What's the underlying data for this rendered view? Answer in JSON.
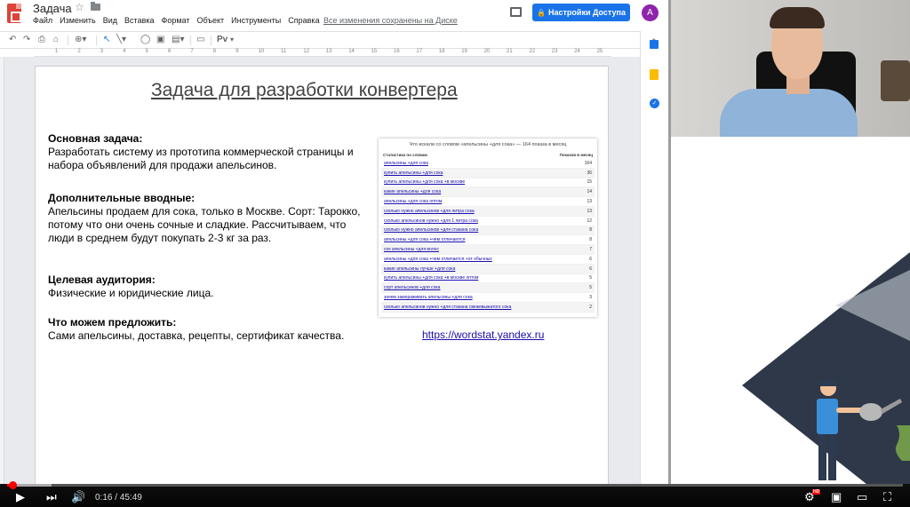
{
  "app": {
    "doc_title": "Задача",
    "menu": [
      "Файл",
      "Изменить",
      "Вид",
      "Вставка",
      "Формат",
      "Объект",
      "Инструменты",
      "Справка"
    ],
    "save_status": "Все изменения сохранены на Диске",
    "share_label": "Настройки Доступа",
    "avatar_letter": "A"
  },
  "toolbar": {
    "font_icon_label": "Pv"
  },
  "ruler": {
    "ticks": [
      "1",
      "2",
      "3",
      "4",
      "5",
      "6",
      "7",
      "8",
      "9",
      "10",
      "11",
      "12",
      "13",
      "14",
      "15",
      "16",
      "17",
      "18",
      "19",
      "20",
      "21",
      "22",
      "23",
      "24",
      "25"
    ]
  },
  "slide": {
    "title": "Задача для разработки конвертера",
    "blocks": [
      {
        "heading": "Основная задача:",
        "body": "Разработать систему из прототипа коммерческой страницы и набора объявлений для продажи апельсинов."
      },
      {
        "heading": "Дополнительные вводные:",
        "body": "Апельсины продаем для сока, только в Москве. Сорт: Тарокко, потому что они очень сочные и сладкие. Рассчитываем, что люди в среднем будут покупать 2-3 кг за раз."
      },
      {
        "heading": "Целевая аудитория:",
        "body": "Физические и юридические лица."
      },
      {
        "heading": "Что можем предложить:",
        "body": "Сами апельсины, доставка, рецепты, сертификат качества."
      }
    ],
    "link": "https://wordstat.yandex.ru"
  },
  "wordstat": {
    "title": "Что искали со словом «апельсины +для сока» — 164 показа в месяц",
    "col_left": "Статистика по словам",
    "col_right": "Показов в месяц",
    "rows": [
      {
        "phrase": "апельсины +для сока",
        "count": "164"
      },
      {
        "phrase": "купить апельсины +для сока",
        "count": "36"
      },
      {
        "phrase": "купить апельсины +для сока +в москве",
        "count": "15"
      },
      {
        "phrase": "какие апельсины +для сока",
        "count": "14"
      },
      {
        "phrase": "апельсины +для сока оптом",
        "count": "13"
      },
      {
        "phrase": "сколько нужно апельсинов +для литра сока",
        "count": "13"
      },
      {
        "phrase": "сколько апельсинов нужно +для 1 литра сока",
        "count": "12"
      },
      {
        "phrase": "сколько нужно апельсинов +для стакана сока",
        "count": "8"
      },
      {
        "phrase": "апельсины +для сока +чем отличаются",
        "count": "8"
      },
      {
        "phrase": "сок апельсины +для волос",
        "count": "7"
      },
      {
        "phrase": "апельсины +для сока +чем отличается +от обычных",
        "count": "6"
      },
      {
        "phrase": "какие апельсины лучше +для сока",
        "count": "6"
      },
      {
        "phrase": "купить апельсины +для сока +в москве оптом",
        "count": "5"
      },
      {
        "phrase": "сорт апельсинов +для сока",
        "count": "5"
      },
      {
        "phrase": "зачем замораживать апельсины +для сока",
        "count": "3"
      },
      {
        "phrase": "сколько апельсинов нужно +для стакана свежевыжатого сока",
        "count": "2"
      }
    ]
  },
  "player": {
    "time": "0:16 / 45:49",
    "hd_badge": "HD",
    "played_fraction": 0.0058,
    "loaded_fraction": 0.05
  },
  "icons": {
    "play": "play-icon",
    "next": "next-icon",
    "volume": "volume-icon",
    "settings": "settings-icon",
    "miniplayer": "miniplayer-icon",
    "theater": "theater-icon",
    "fullscreen": "fullscreen-icon"
  }
}
